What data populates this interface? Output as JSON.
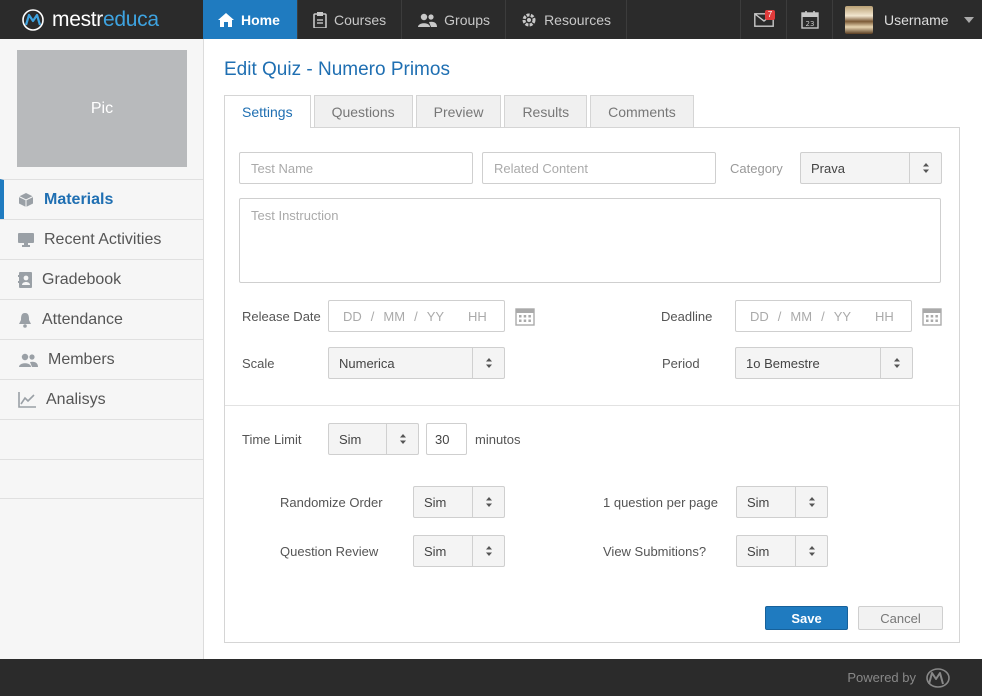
{
  "brand": {
    "name_prefix": "mestr",
    "name_accent": "educa"
  },
  "topnav": {
    "items": [
      {
        "label": "Home",
        "icon": "home-icon",
        "active": true
      },
      {
        "label": "Courses",
        "icon": "clipboard-icon"
      },
      {
        "label": "Groups",
        "icon": "users-icon"
      },
      {
        "label": "Resources",
        "icon": "gear-icon"
      }
    ],
    "mail_badge": "7",
    "calendar_day": "23",
    "username": "Username"
  },
  "sidebar": {
    "pic_label": "Pic",
    "items": [
      {
        "label": "Materials",
        "icon": "cube-icon",
        "active": true
      },
      {
        "label": "Recent Activities",
        "icon": "monitor-icon"
      },
      {
        "label": "Gradebook",
        "icon": "contact-book-icon"
      },
      {
        "label": "Attendance",
        "icon": "bell-icon"
      },
      {
        "label": "Members",
        "icon": "users-icon"
      },
      {
        "label": "Analisys",
        "icon": "line-chart-icon"
      }
    ]
  },
  "page": {
    "title": "Edit Quiz - Numero Primos",
    "tabs": [
      "Settings",
      "Questions",
      "Preview",
      "Results",
      "Comments"
    ]
  },
  "form": {
    "test_name_placeholder": "Test Name",
    "related_content_placeholder": "Related Content",
    "category_label": "Category",
    "category_value": "Prava",
    "instruction_placeholder": "Test Instruction",
    "release_date_label": "Release Date",
    "deadline_label": "Deadline",
    "date_placeholder": {
      "dd": "DD",
      "mm": "MM",
      "yy": "YY",
      "hh": "HH",
      "sep": "/"
    },
    "scale_label": "Scale",
    "scale_value": "Numerica",
    "period_label": "Period",
    "period_value": "1o Bemestre",
    "time_limit_label": "Time Limit",
    "time_limit_value": "Sim",
    "minutes_value": "30",
    "minutes_label": "minutos",
    "randomize_label": "Randomize Order",
    "randomize_value": "Sim",
    "per_page_label": "1 question per page",
    "per_page_value": "Sim",
    "review_label": "Question Review",
    "review_value": "Sim",
    "submissions_label": "View Submitions?",
    "submissions_value": "Sim",
    "save_label": "Save",
    "cancel_label": "Cancel"
  },
  "footer": {
    "powered_by": "Powered by"
  },
  "colors": {
    "accent": "#1f7bc0",
    "topbar": "#2b2b2b",
    "badge": "#e03b3b"
  }
}
